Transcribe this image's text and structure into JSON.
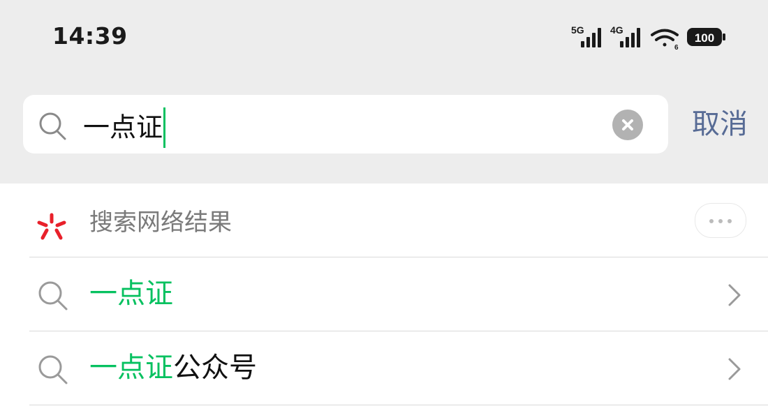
{
  "status_bar": {
    "time": "14:39",
    "network_1": "5G",
    "network_2": "4G",
    "battery": "100"
  },
  "search": {
    "query": "一点证",
    "cancel_label": "取消"
  },
  "web_search": {
    "label": "搜索网络结果"
  },
  "suggestions": [
    {
      "highlight": "一点证",
      "rest": ""
    },
    {
      "highlight": "一点证",
      "rest": "公众号"
    }
  ],
  "colors": {
    "accent": "#07c160",
    "link": "#576b95",
    "header_bg": "#ededed"
  }
}
